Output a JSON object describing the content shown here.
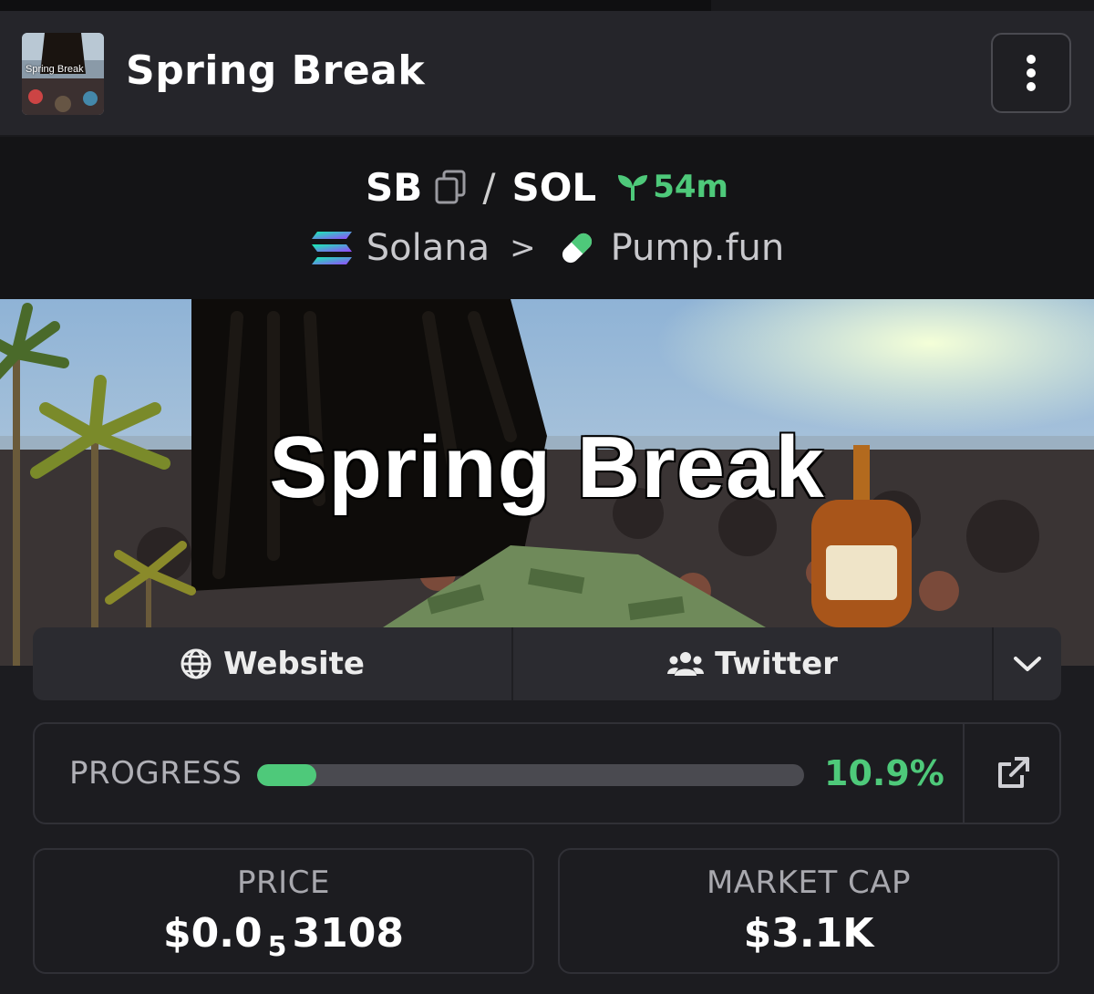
{
  "header": {
    "title": "Spring Break",
    "avatar_text": "Spring Break"
  },
  "pair": {
    "base": "SB",
    "separator": "/",
    "quote": "SOL",
    "age": "54m",
    "chain": "Solana",
    "chevron": ">",
    "dex": "Pump.fun"
  },
  "banner": {
    "text": "Spring Break"
  },
  "links": {
    "website": "Website",
    "twitter": "Twitter"
  },
  "progress": {
    "label": "PROGRESS",
    "value_text": "10.9%",
    "fraction": 0.109
  },
  "stats": {
    "price_label": "PRICE",
    "price_main": "$0.0",
    "price_zeros": "5",
    "price_digits": "3108",
    "mcap_label": "MARKET CAP",
    "mcap_value": "$3.1K"
  },
  "colors": {
    "accent_green": "#4ec97a",
    "background": "#1c1c20"
  },
  "icons": [
    "copy-icon",
    "sprout-icon",
    "solana-icon",
    "pill-icon",
    "globe-icon",
    "users-icon",
    "chevron-down-icon",
    "external-link-icon",
    "more-vertical-icon"
  ]
}
